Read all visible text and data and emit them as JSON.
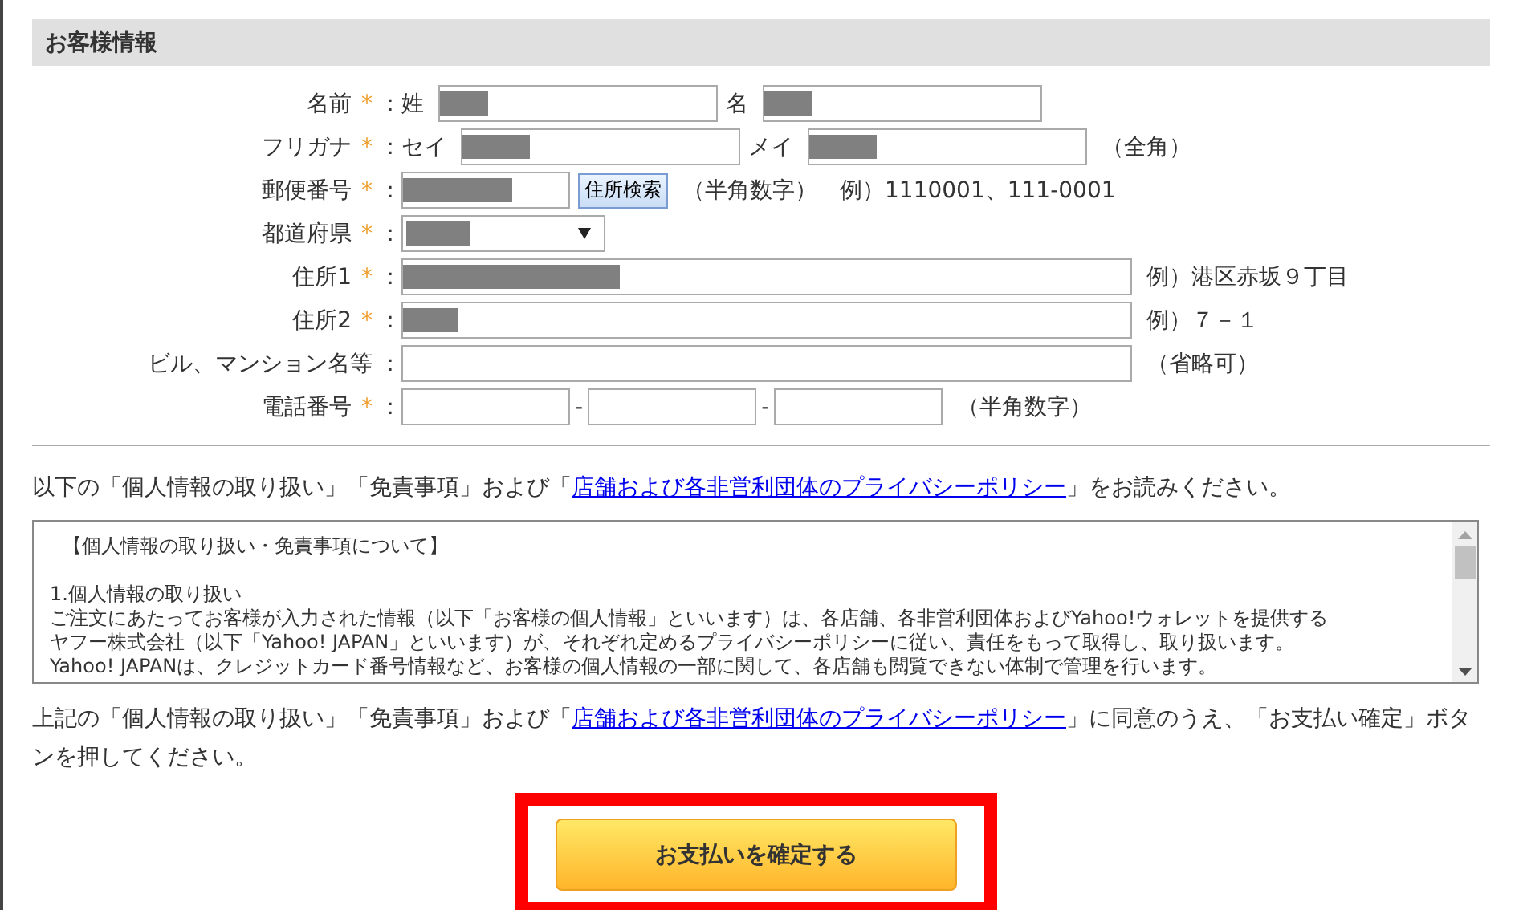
{
  "section": {
    "title": "お客様情報"
  },
  "fields": [
    {
      "label": "名前",
      "required": true,
      "parts": [
        {
          "kind": "prefix",
          "text": "姓"
        },
        {
          "kind": "input",
          "redacted": true
        },
        {
          "kind": "prefix",
          "text": "名"
        },
        {
          "kind": "input",
          "redacted": true
        }
      ]
    },
    {
      "label": "フリガナ",
      "required": true,
      "parts": [
        {
          "kind": "prefix",
          "text": "セイ"
        },
        {
          "kind": "input",
          "redacted": true
        },
        {
          "kind": "prefix",
          "text": "メイ"
        },
        {
          "kind": "input",
          "redacted": true
        },
        {
          "kind": "note",
          "text": "（全角）"
        }
      ]
    },
    {
      "label": "郵便番号",
      "required": true,
      "parts": [
        {
          "kind": "input",
          "redacted": true
        },
        {
          "kind": "button",
          "text": "住所検索"
        },
        {
          "kind": "note",
          "text": "（半角数字）　例）1110001、111-0001"
        }
      ]
    },
    {
      "label": "都道府県",
      "required": true,
      "parts": [
        {
          "kind": "select",
          "redacted": true
        }
      ]
    },
    {
      "label": "住所1",
      "required": true,
      "parts": [
        {
          "kind": "input",
          "redacted": true
        },
        {
          "kind": "note",
          "text": "例）港区赤坂９丁目"
        }
      ]
    },
    {
      "label": "住所2",
      "required": true,
      "parts": [
        {
          "kind": "input",
          "redacted": true
        },
        {
          "kind": "note",
          "text": "例）７－１"
        }
      ]
    },
    {
      "label": "ビル、マンション名等",
      "required": false,
      "parts": [
        {
          "kind": "input",
          "redacted": false
        },
        {
          "kind": "note",
          "text": "（省略可）"
        }
      ]
    },
    {
      "label": "電話番号",
      "required": true,
      "parts": [
        {
          "kind": "input",
          "redacted": false
        },
        {
          "kind": "separator",
          "text": "-"
        },
        {
          "kind": "input",
          "redacted": false
        },
        {
          "kind": "separator",
          "text": "-"
        },
        {
          "kind": "input",
          "redacted": false
        },
        {
          "kind": "note",
          "text": "（半角数字）"
        }
      ]
    }
  ],
  "required_mark": "*",
  "colon": "：",
  "intro": {
    "before": "以下の「個人情報の取り扱い」「免責事項」および「",
    "link": "店舗および各非営利団体のプライバシーポリシー",
    "after": "」をお読みください。"
  },
  "terms_box": {
    "heading": "【個人情報の取り扱い・免責事項について】",
    "lines": [
      "1.個人情報の取り扱い",
      "ご注文にあたってお客様が入力された情報（以下「お客様の個人情報」といいます）は、各店舗、各非営利団体およびYahoo!ウォレットを提供する",
      "ヤフー株式会社（以下「Yahoo! JAPAN」といいます）が、それぞれ定めるプライバシーポリシーに従い、責任をもって取得し、取り扱います。",
      "Yahoo! JAPANは、クレジットカード番号情報など、お客様の個人情報の一部に関して、各店舗も閲覧できない体制で管理を行います。"
    ]
  },
  "agreement": {
    "before": "上記の「個人情報の取り扱い」「免責事項」および「",
    "link": "店舗および各非営利団体のプライバシーポリシー",
    "after": "」に同意のうえ、「お支払い確定」ボタンを押してください。"
  },
  "confirm_button": {
    "label": "お支払いを確定する",
    "highlighted": true
  }
}
